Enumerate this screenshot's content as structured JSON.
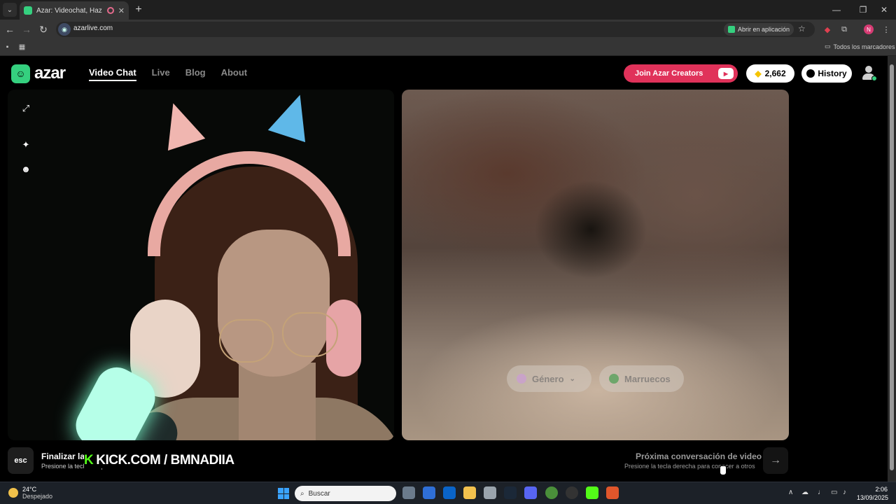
{
  "browser": {
    "tab_title": "Azar: Videochat, Haz nuevo",
    "tab_close": "✕",
    "new_tab": "+",
    "url": "azarlive.com",
    "open_app_label": "Abrir en aplicación",
    "profile_initial": "N",
    "bookmarks_all": "Todos los marcadores"
  },
  "site": {
    "logo_text": "azar",
    "nav": [
      "Video Chat",
      "Live",
      "Blog",
      "About"
    ],
    "creators_label": "Join Azar Creators",
    "gems_count": "2,662",
    "history_label": "History"
  },
  "chat": {
    "filter_gender": "Género",
    "filter_country": "Marruecos",
    "esc_label": "esc",
    "end_title": "Finalizar la",
    "end_sub": "Presione la tecla esc para finalizar el chat de video",
    "overlay_k": "K",
    "overlay_text": "KICK.COM / BMNADIIA",
    "next_title": "Próxima conversación de video",
    "next_sub": "Presione la tecla derecha para conocer a otros",
    "next_arrow": "→"
  },
  "taskbar": {
    "temp": "24°C",
    "condition": "Despejado",
    "search_placeholder": "Buscar",
    "time": "2:06",
    "date": "13/09/2025"
  },
  "colors": {
    "brand_green": "#35d07f",
    "creators_red": "#e0325a",
    "kick_green": "#53fc18"
  }
}
